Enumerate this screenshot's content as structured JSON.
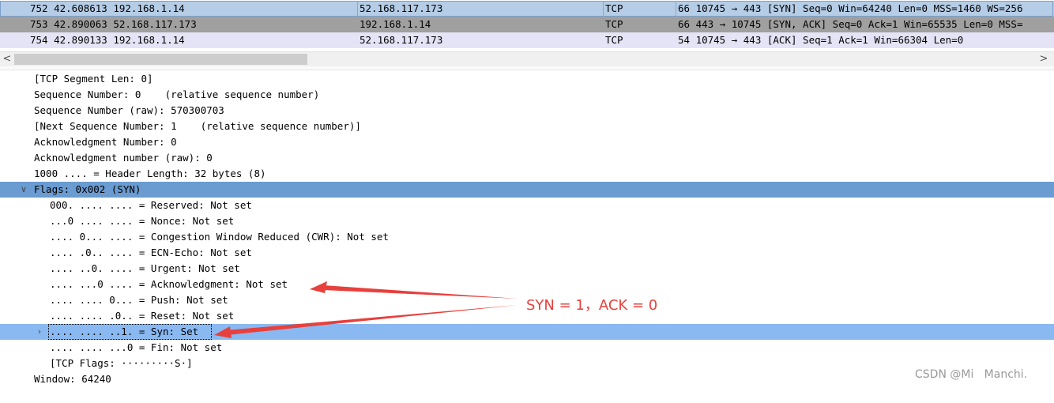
{
  "packets": [
    {
      "no_time_src": "752 42.608613 192.168.1.14",
      "dst": "52.168.117.173",
      "proto": "TCP",
      "info": "66 10745 → 443 [SYN] Seq=0 Win=64240 Len=0 MSS=1460 WS=256"
    },
    {
      "no_time_src": "753 42.890063 52.168.117.173",
      "dst": "192.168.1.14",
      "proto": "TCP",
      "info": "66 443 → 10745 [SYN, ACK] Seq=0 Ack=1 Win=65535 Len=0 MSS="
    },
    {
      "no_time_src": "754 42.890133 192.168.1.14",
      "dst": "52.168.117.173",
      "proto": "TCP",
      "info": "54 10745 → 443 [ACK] Seq=1 Ack=1 Win=66304 Len=0"
    }
  ],
  "scrollbar": {
    "left_arrow": "<",
    "right_arrow": ">"
  },
  "details": [
    "[TCP Segment Len: 0]",
    "Sequence Number: 0    (relative sequence number)",
    "Sequence Number (raw): 570300703",
    "[Next Sequence Number: 1    (relative sequence number)]",
    "Acknowledgment Number: 0",
    "Acknowledgment number (raw): 0",
    "1000 .... = Header Length: 32 bytes (8)",
    "Flags: 0x002 (SYN)",
    "000. .... .... = Reserved: Not set",
    "...0 .... .... = Nonce: Not set",
    ".... 0... .... = Congestion Window Reduced (CWR): Not set",
    ".... .0.. .... = ECN-Echo: Not set",
    ".... ..0. .... = Urgent: Not set",
    ".... ...0 .... = Acknowledgment: Not set",
    ".... .... 0... = Push: Not set",
    ".... .... .0.. = Reset: Not set",
    ".... .... ..1. = Syn: Set",
    ".... .... ...0 = Fin: Not set",
    "[TCP Flags: ·········S·]",
    "Window: 64240"
  ],
  "expanders": {
    "flags": "∨",
    "syn": "›"
  },
  "annotation": {
    "text": "SYN = 1，ACK = 0",
    "color": "#e8403c"
  },
  "watermark": "CSDN @Mi   Manchi.",
  "colors": {
    "selected_packet": "#b5cde6",
    "packet_row_2": "#a0a0a0",
    "packet_row_3": "#e4e4f6",
    "flags_highlight": "#6a9bd1",
    "syn_highlight": "#8ab9f2"
  }
}
